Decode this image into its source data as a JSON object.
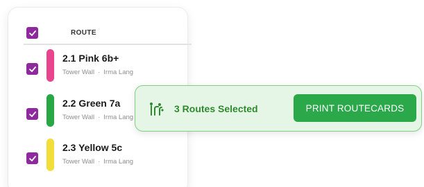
{
  "colors": {
    "checkbox": "#8e2a9e",
    "toast_bg": "#e6f6e6",
    "toast_border": "#7fd07f",
    "toast_text": "#2f8a2f",
    "button": "#2aa84a"
  },
  "table": {
    "header_label": "ROUTE",
    "header_checked": true
  },
  "routes": [
    {
      "name": "2.1 Pink 6b+",
      "wall": "Tower Wall",
      "setter": "Irma Lang",
      "color": "#e8458e",
      "checked": true
    },
    {
      "name": "2.2 Green 7a",
      "wall": "Tower Wall",
      "setter": "Irma Lang",
      "color": "#28a745",
      "checked": true
    },
    {
      "name": "2.3 Yellow 5c",
      "wall": "Tower Wall",
      "setter": "Irma Lang",
      "color": "#f3dd3a",
      "checked": true
    }
  ],
  "toast": {
    "icon": "routes-icon",
    "text": "3 Routes Selected",
    "button_label": "PRINT ROUTECARDS"
  }
}
